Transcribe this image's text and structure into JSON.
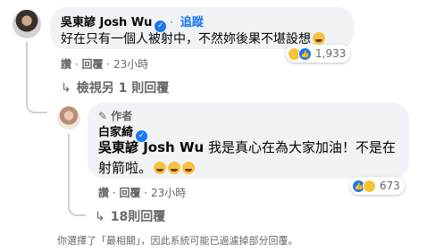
{
  "comment1": {
    "author": "吳東諺 Josh Wu",
    "follow_label": "追蹤",
    "text": "好在只有一個人被射中，不然妳後果不堪設想",
    "actions": {
      "like": "讚",
      "reply": "回覆",
      "time": "23小時"
    },
    "reaction_count": "1,933",
    "view_replies": "檢視另 1 則回覆"
  },
  "comment2": {
    "author_badge": "作者",
    "author": "白家綺",
    "mention": "吳東諺 Josh Wu",
    "text": " 我是真心在為大家加油！不是在射箭啦。",
    "actions": {
      "like": "讚",
      "reply": "回覆",
      "time": "23小時"
    },
    "reaction_count": "673",
    "replies_link": "18則回覆"
  },
  "footnote": "你選擇了「最相關」，因此系統可能已過濾掉部分回覆。",
  "icons": {
    "reply_arrow": "↳",
    "verified": "✓",
    "author_badge": "pen-icon"
  },
  "colors": {
    "link_blue": "#1877f2",
    "bubble_bg": "#f0f2f5",
    "muted": "#65676b"
  }
}
